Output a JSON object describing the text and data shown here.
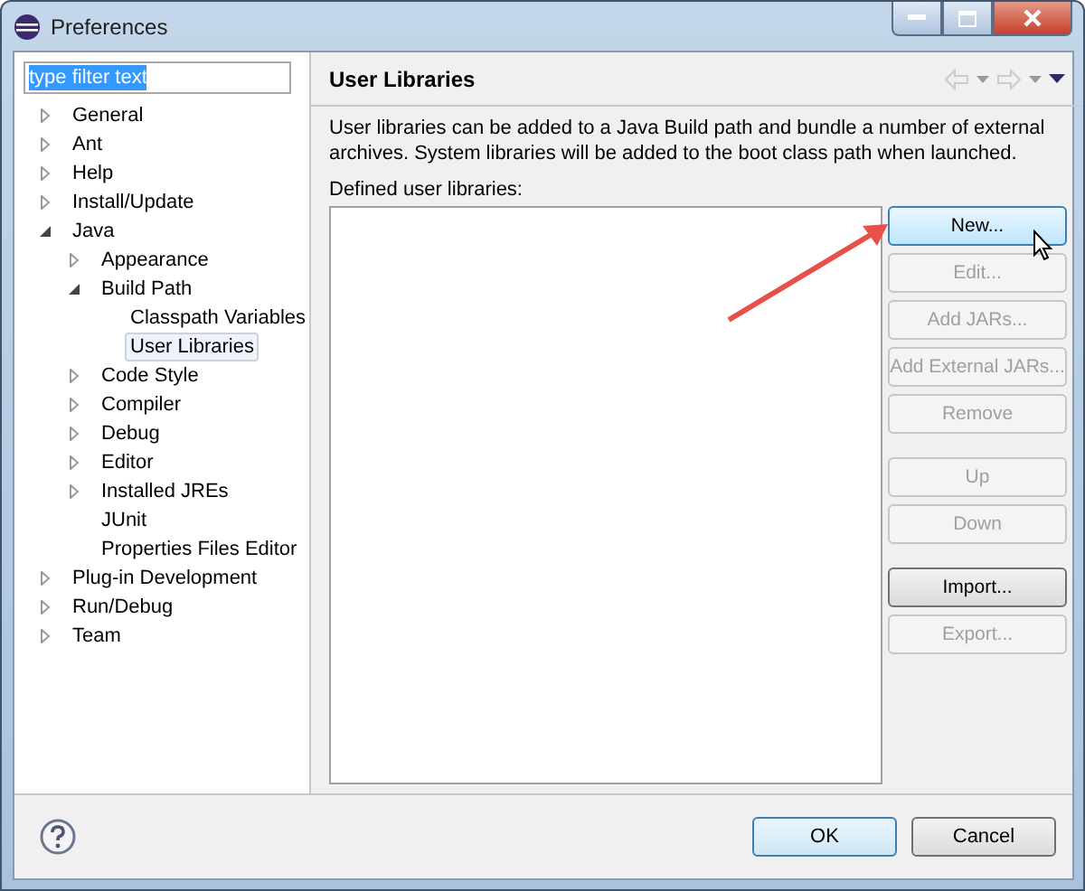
{
  "window": {
    "title": "Preferences"
  },
  "filter": {
    "value": "type filter text"
  },
  "tree": [
    {
      "label": "General",
      "expanded": false,
      "selected": false
    },
    {
      "label": "Ant",
      "expanded": false,
      "selected": false
    },
    {
      "label": "Help",
      "expanded": false,
      "selected": false
    },
    {
      "label": "Install/Update",
      "expanded": false,
      "selected": false
    },
    {
      "label": "Java",
      "expanded": true,
      "selected": false,
      "children": [
        {
          "label": "Appearance",
          "expanded": false,
          "selected": false
        },
        {
          "label": "Build Path",
          "expanded": true,
          "selected": false,
          "children": [
            {
              "label": "Classpath Variables",
              "selected": false
            },
            {
              "label": "User Libraries",
              "selected": true
            }
          ]
        },
        {
          "label": "Code Style",
          "expanded": false,
          "selected": false
        },
        {
          "label": "Compiler",
          "expanded": false,
          "selected": false
        },
        {
          "label": "Debug",
          "expanded": false,
          "selected": false
        },
        {
          "label": "Editor",
          "expanded": false,
          "selected": false
        },
        {
          "label": "Installed JREs",
          "expanded": false,
          "selected": false
        },
        {
          "label": "JUnit",
          "selected": false
        },
        {
          "label": "Properties Files Editor",
          "selected": false
        }
      ]
    },
    {
      "label": "Plug-in Development",
      "expanded": false,
      "selected": false
    },
    {
      "label": "Run/Debug",
      "expanded": false,
      "selected": false
    },
    {
      "label": "Team",
      "expanded": false,
      "selected": false
    }
  ],
  "page": {
    "title": "User Libraries",
    "description": "User libraries can be added to a Java Build path and bundle a number of external archives. System libraries will be added to the boot class path when launched.",
    "list_label": "Defined user libraries:"
  },
  "button_groups": [
    [
      {
        "label": "New...",
        "disabled": false,
        "hovered": true
      },
      {
        "label": "Edit...",
        "disabled": true,
        "hovered": false
      },
      {
        "label": "Add JARs...",
        "disabled": true,
        "hovered": false
      },
      {
        "label": "Add External JARs...",
        "disabled": true,
        "hovered": false
      },
      {
        "label": "Remove",
        "disabled": true,
        "hovered": false
      }
    ],
    [
      {
        "label": "Up",
        "disabled": true,
        "hovered": false
      },
      {
        "label": "Down",
        "disabled": true,
        "hovered": false
      }
    ],
    [
      {
        "label": "Import...",
        "disabled": false,
        "hovered": false
      },
      {
        "label": "Export...",
        "disabled": true,
        "hovered": false
      }
    ]
  ],
  "dialog_buttons": [
    {
      "label": "OK",
      "default": true
    },
    {
      "label": "Cancel",
      "default": false
    }
  ]
}
